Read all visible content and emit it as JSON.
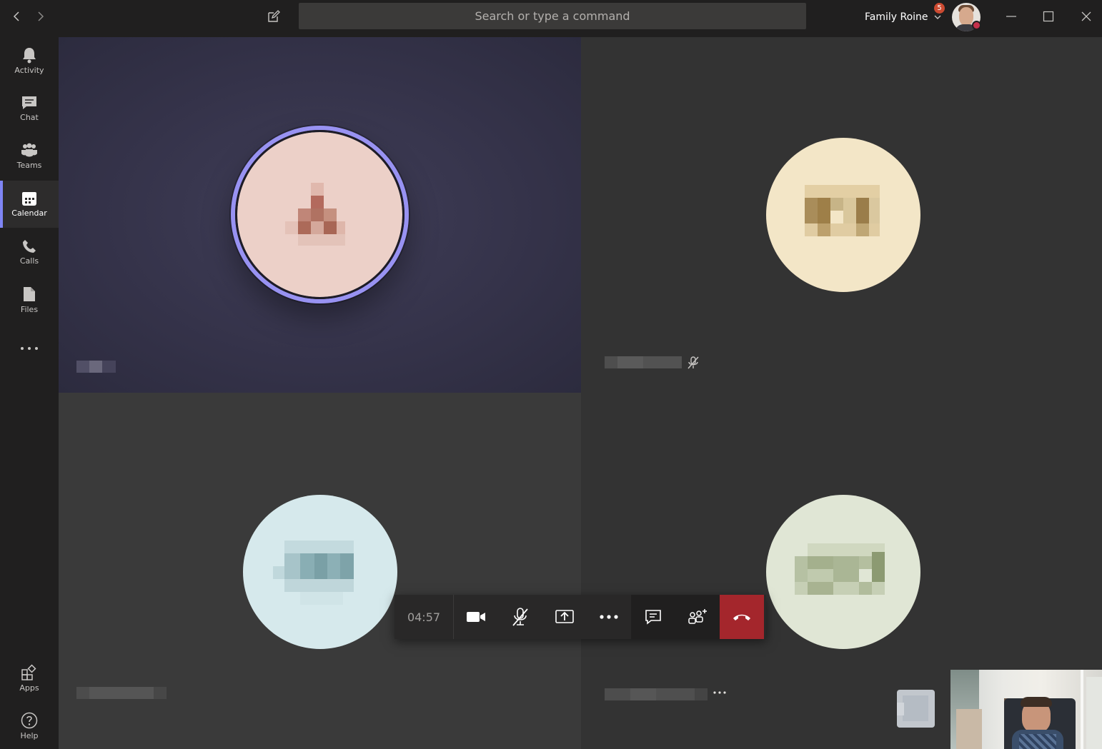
{
  "titlebar": {
    "search_placeholder": "Search or type a command",
    "org_name": "Family Roine",
    "notification_count": "5",
    "presence_status": "busy",
    "colors": {
      "background": "#201f1f",
      "search_bg": "#3b3a39",
      "badge": "#cc4a31",
      "presence": "#c4314b"
    }
  },
  "rail": {
    "items": [
      {
        "label": "Activity",
        "icon": "bell-icon"
      },
      {
        "label": "Chat",
        "icon": "chat-icon"
      },
      {
        "label": "Teams",
        "icon": "teams-icon"
      },
      {
        "label": "Calendar",
        "icon": "calendar-icon",
        "active": true
      },
      {
        "label": "Calls",
        "icon": "phone-icon"
      },
      {
        "label": "Files",
        "icon": "file-icon"
      }
    ],
    "bottom": [
      {
        "label": "Apps",
        "icon": "apps-icon"
      },
      {
        "label": "Help",
        "icon": "help-icon"
      }
    ],
    "accent": "#7f85f5"
  },
  "call": {
    "timer": "04:57",
    "participants": [
      {
        "tile": "top-left",
        "speaking": true,
        "name_blurred": true,
        "avatar_color": "#ecd0c8"
      },
      {
        "tile": "top-right",
        "muted": true,
        "name_blurred": true,
        "avatar_color": "#f3e6c7"
      },
      {
        "tile": "bottom-left",
        "name_blurred": true,
        "avatar_color": "#d6e9ec"
      },
      {
        "tile": "bottom-right",
        "more_options": true,
        "name_blurred": true,
        "avatar_color": "#e0e6d5"
      }
    ],
    "controls": [
      "camera-icon",
      "mic-off-icon",
      "share-screen-icon",
      "more-icon",
      "chat-toggle-icon",
      "participants-icon",
      "hang-up-icon"
    ],
    "hangup_color": "#a4262c",
    "speaking_ring_color": "#9892f2"
  }
}
